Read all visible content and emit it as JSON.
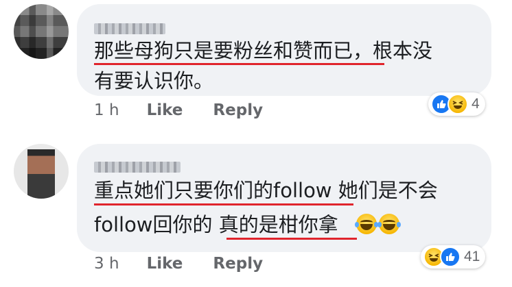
{
  "comments": [
    {
      "line1": "那些母狗只是要粉丝和赞而已，根本没",
      "line2": "有要认识你。",
      "time": "1 h",
      "like_label": "Like",
      "reply_label": "Reply",
      "reactions": [
        "like-icon",
        "haha-icon"
      ],
      "reaction_count": "4"
    },
    {
      "line1": "重点她们只要你们的follow 她们是不会",
      "line2": "follow回你的 真的是柑你拿",
      "time": "3 h",
      "like_label": "Like",
      "reply_label": "Reply",
      "reactions": [
        "haha-icon",
        "like-icon"
      ],
      "reaction_count": "41"
    }
  ],
  "colors": {
    "bubble": "#f0f2f5",
    "underline": "#e0242c",
    "meta": "#65676b",
    "like": "#1877f2"
  }
}
